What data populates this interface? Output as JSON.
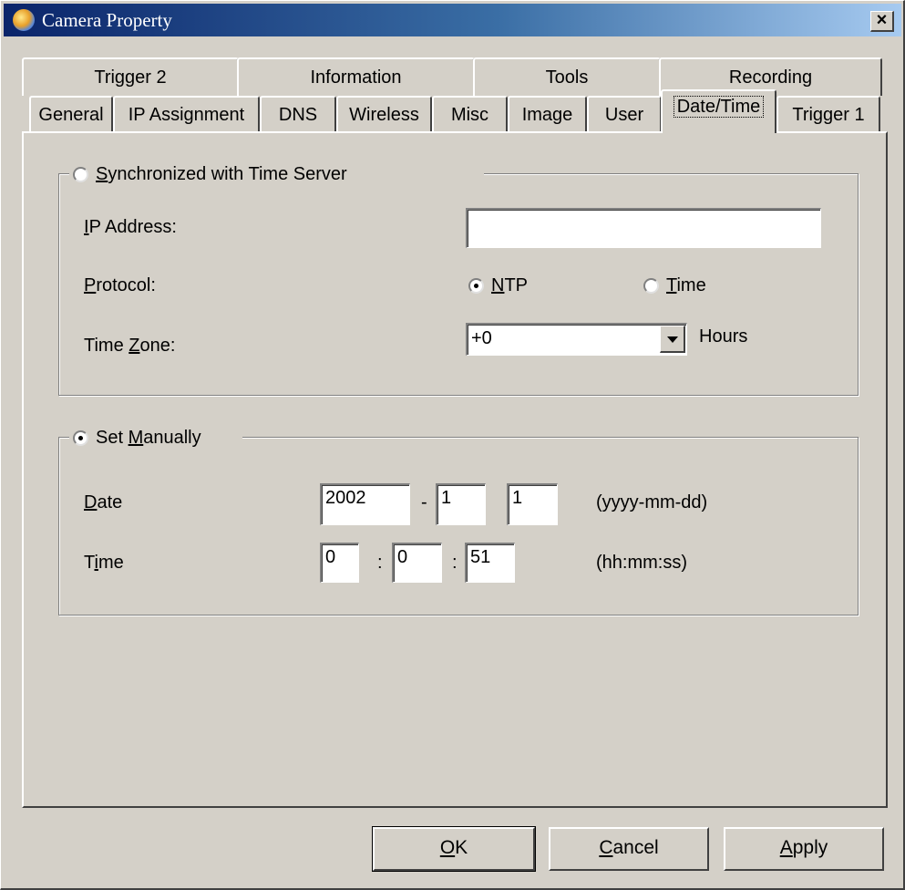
{
  "window": {
    "title": "Camera Property",
    "close_label": "×"
  },
  "tabs_row1": [
    "Trigger 2",
    "Information",
    "Tools",
    "Recording"
  ],
  "tabs_row2": [
    "General",
    "IP Assignment",
    "DNS",
    "Wireless",
    "Misc",
    "Image",
    "User",
    "Date/Time",
    "Trigger 1"
  ],
  "active_tab": "Date/Time",
  "sync": {
    "legend_u": "S",
    "legend_rest": "ynchronized with Time Server",
    "selected": false,
    "ip_label_u": "I",
    "ip_label_rest": "P Address:",
    "ip_value": "",
    "protocol_label_u": "P",
    "protocol_label_rest": "rotocol:",
    "ntp_u": "N",
    "ntp_rest": "TP",
    "ntp_selected": true,
    "time_u": "T",
    "time_rest": "ime",
    "time_selected": false,
    "tz_label_pre": "Time ",
    "tz_label_u": "Z",
    "tz_label_rest": "one:",
    "tz_value": "+0",
    "hours_label": "Hours"
  },
  "manual": {
    "legend_pre": "Set ",
    "legend_u": "M",
    "legend_rest": "anually",
    "selected": true,
    "date_label_u": "D",
    "date_label_rest": "ate",
    "year": "2002",
    "month": "1",
    "day": "1",
    "date_sep": "-",
    "date_format": "(yyyy-mm-dd)",
    "time_label_pre": "T",
    "time_label_u": "i",
    "time_label_rest": "me",
    "hour": "0",
    "minute": "0",
    "second": "51",
    "time_sep": ":",
    "time_format": "(hh:mm:ss)"
  },
  "buttons": {
    "ok_u": "O",
    "ok_rest": "K",
    "cancel_u": "C",
    "cancel_rest": "ancel",
    "apply_u": "A",
    "apply_rest": "pply"
  }
}
